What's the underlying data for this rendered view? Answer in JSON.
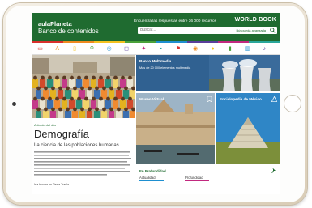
{
  "brand": {
    "line1": "aulaPlaneta",
    "line2": "Banco de contenidos",
    "top_right": "WORLD BOOK"
  },
  "header": {
    "promo": "Encuentra las respuestas entre 36 000 recursos",
    "search_placeholder": "Buscar...",
    "advanced": "Búsqueda avanzada"
  },
  "colors": {
    "primary": "#1f6b30",
    "strip": [
      "#d9302c",
      "#ef8a1f",
      "#f4c21f",
      "#4aa23a",
      "#1e8fd0",
      "#5a3e9b",
      "#c2297f",
      "#2aa79b"
    ]
  },
  "icons": [
    "monitor-icon",
    "text-icon",
    "book-icon",
    "map-pin-icon",
    "compass-icon",
    "chat-icon",
    "molecule-icon",
    "briefcase-icon",
    "flag-icon",
    "target-icon",
    "person-icon",
    "folder-icon",
    "chart-icon",
    "music-icon"
  ],
  "article": {
    "kicker": "Artículo del día",
    "title": "Demografía",
    "subtitle": "La ciencia de las poblaciones humanas",
    "caption": "Ir a buscar en Tierra Trasla"
  },
  "tiles": {
    "bank": {
      "title": "Banco Multimedia",
      "desc": "Más de 20 000 elementos multimedia"
    },
    "museum": {
      "title": "Museo Virtual"
    },
    "encyclopedia": {
      "title": "Enciclopedia de México"
    }
  },
  "news": {
    "title": "En Profundidad",
    "tabs": [
      "Actualidad",
      "Profundidad"
    ]
  }
}
